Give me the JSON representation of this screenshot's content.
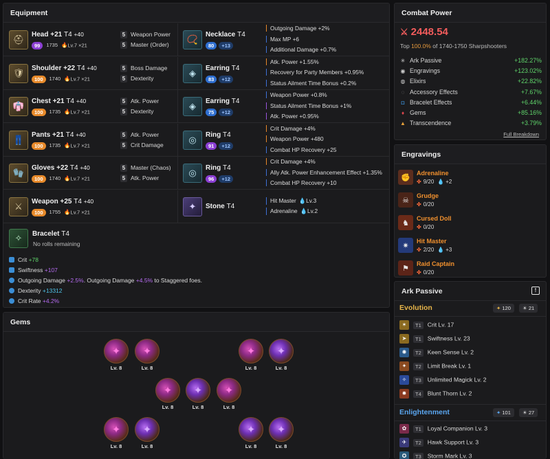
{
  "equipment": {
    "title": "Equipment",
    "armor": [
      {
        "slot": "Head",
        "upgrade": "+21",
        "tier": "T4",
        "adv": "+40",
        "quality": "99",
        "quality_color": "#8b3fd3",
        "ilvl": "1735",
        "elixir": "Lv.7 ×21",
        "icon": "⛑",
        "mods": [
          {
            "n": "5",
            "label": "Weapon Power"
          },
          {
            "n": "5",
            "label": "Master (Order)"
          }
        ]
      },
      {
        "slot": "Shoulder",
        "upgrade": "+22",
        "tier": "T4",
        "adv": "+40",
        "quality": "100",
        "quality_color": "#e78a2b",
        "ilvl": "1740",
        "elixir": "Lv.7 ×21",
        "icon": "🛡",
        "mods": [
          {
            "n": "5",
            "label": "Boss Damage"
          },
          {
            "n": "5",
            "label": "Dexterity"
          }
        ]
      },
      {
        "slot": "Chest",
        "upgrade": "+21",
        "tier": "T4",
        "adv": "+40",
        "quality": "100",
        "quality_color": "#e78a2b",
        "ilvl": "1735",
        "elixir": "Lv.7 ×21",
        "icon": "👘",
        "mods": [
          {
            "n": "5",
            "label": "Atk. Power"
          },
          {
            "n": "5",
            "label": "Dexterity"
          }
        ]
      },
      {
        "slot": "Pants",
        "upgrade": "+21",
        "tier": "T4",
        "adv": "+40",
        "quality": "100",
        "quality_color": "#e78a2b",
        "ilvl": "1735",
        "elixir": "Lv.7 ×21",
        "icon": "👖",
        "mods": [
          {
            "n": "5",
            "label": "Atk. Power"
          },
          {
            "n": "5",
            "label": "Crit Damage"
          }
        ]
      },
      {
        "slot": "Gloves",
        "upgrade": "+22",
        "tier": "T4",
        "adv": "+40",
        "quality": "100",
        "quality_color": "#e78a2b",
        "ilvl": "1740",
        "elixir": "Lv.7 ×21",
        "icon": "🧤",
        "mods": [
          {
            "n": "5",
            "label": "Master (Chaos)"
          },
          {
            "n": "5",
            "label": "Atk. Power"
          }
        ]
      },
      {
        "slot": "Weapon",
        "upgrade": "+25",
        "tier": "T4",
        "adv": "+40",
        "quality": "100",
        "quality_color": "#e78a2b",
        "ilvl": "1755",
        "elixir": "Lv.7 ×21",
        "icon": "⚔",
        "mods": []
      }
    ],
    "accessories": [
      {
        "slot": "Necklace",
        "tier": "T4",
        "quality": "80",
        "quality_color": "#2f6fd0",
        "bonus": "+13",
        "icon": "📿",
        "effects": [
          {
            "text": "Outgoing Damage +2%",
            "bar": "o"
          },
          {
            "text": "Max MP +6",
            "bar": "b"
          },
          {
            "text": "Additional Damage +0.7%",
            "bar": "b"
          }
        ]
      },
      {
        "slot": "Earring",
        "tier": "T4",
        "quality": "83",
        "quality_color": "#2f6fd0",
        "bonus": "+12",
        "icon": "◈",
        "effects": [
          {
            "text": "Atk. Power +1.55%",
            "bar": "o"
          },
          {
            "text": "Recovery for Party Members +0.95%",
            "bar": "b"
          },
          {
            "text": "Status Ailment Time Bonus +0.2%",
            "bar": "b"
          }
        ]
      },
      {
        "slot": "Earring",
        "tier": "T4",
        "quality": "75",
        "quality_color": "#2f6fd0",
        "bonus": "+12",
        "icon": "◈",
        "effects": [
          {
            "text": "Weapon Power +0.8%",
            "bar": "b"
          },
          {
            "text": "Status Ailment Time Bonus +1%",
            "bar": "p"
          },
          {
            "text": "Atk. Power +0.95%",
            "bar": "p"
          }
        ]
      },
      {
        "slot": "Ring",
        "tier": "T4",
        "quality": "91",
        "quality_color": "#8b3fd3",
        "bonus": "+12",
        "icon": "◎",
        "effects": [
          {
            "text": "Crit Damage +4%",
            "bar": "o"
          },
          {
            "text": "Weapon Power +480",
            "bar": "o"
          },
          {
            "text": "Combat HP Recovery +25",
            "bar": "b"
          }
        ]
      },
      {
        "slot": "Ring",
        "tier": "T4",
        "quality": "96",
        "quality_color": "#8b3fd3",
        "bonus": "+12",
        "icon": "◎",
        "effects": [
          {
            "text": "Crit Damage +4%",
            "bar": "o"
          },
          {
            "text": "Ally Atk. Power Enhancement Effect +1.35%",
            "bar": "b"
          },
          {
            "text": "Combat HP Recovery +10",
            "bar": "b"
          }
        ]
      },
      {
        "slot": "Stone",
        "tier": "T4",
        "icon": "✦",
        "effects": [
          {
            "text": "Hit Master",
            "lv": "Lv.3",
            "bar": "b"
          },
          {
            "text": "Adrenaline",
            "lv": "Lv.2",
            "bar": "b"
          }
        ]
      }
    ],
    "bracelet": {
      "slot": "Bracelet",
      "tier": "T4",
      "note": "No rolls remaining",
      "icon": "✧",
      "stats": [
        {
          "icon": "lock",
          "label": "Crit",
          "value": "+78",
          "color": "#5fd36a"
        },
        {
          "icon": "lock",
          "label": "Swiftness",
          "value": "+107",
          "color": "#b56bf0"
        },
        {
          "icon": "reroll",
          "label": "Outgoing Damage",
          "value": "+2.5%",
          "color": "#b56bf0",
          "label2": ". Outgoing Damage",
          "value2": "+4.5%",
          "label3": " to Staggered foes."
        },
        {
          "icon": "reroll",
          "label": "Dexterity",
          "value": "+13312",
          "color": "#4fc3e8"
        },
        {
          "icon": "reroll",
          "label": "Crit Rate",
          "value": "+4.2%",
          "color": "#b56bf0"
        }
      ]
    }
  },
  "gems": {
    "title": "Gems",
    "items": [
      {
        "lv": "Lv. 8",
        "kind": "damage"
      },
      {
        "lv": "Lv. 8",
        "kind": "damage"
      },
      {
        "lv": "Lv. 8",
        "kind": "damage"
      },
      {
        "lv": "Lv. 8",
        "kind": "cooldown"
      },
      {
        "lv": "Lv. 8",
        "kind": "damage"
      },
      {
        "lv": "Lv. 8",
        "kind": "cooldown"
      },
      {
        "lv": "Lv. 8",
        "kind": "damage"
      },
      {
        "lv": "Lv. 8",
        "kind": "damage"
      },
      {
        "lv": "Lv. 8",
        "kind": "cooldown"
      },
      {
        "lv": "Lv. 8",
        "kind": "cooldown"
      },
      {
        "lv": "Lv. 8",
        "kind": "cooldown"
      }
    ]
  },
  "combat_power": {
    "title": "Combat Power",
    "value": "2448.54",
    "top_prefix": "Top ",
    "top_pct": "100.0%",
    "top_suffix": " of 1740-1750 Sharpshooters",
    "rows": [
      {
        "label": "Ark Passive",
        "value": "+182.27%",
        "icon": "✳",
        "color": "#cfcfcf"
      },
      {
        "label": "Engravings",
        "value": "+123.02%",
        "icon": "◉",
        "color": "#cfcfcf"
      },
      {
        "label": "Elixirs",
        "value": "+22.82%",
        "icon": "◍",
        "color": "#cfcfcf"
      },
      {
        "label": "Accessory Effects",
        "value": "+7.67%",
        "icon": "◌",
        "color": "#8e8e8e"
      },
      {
        "label": "Bracelet Effects",
        "value": "+6.44%",
        "icon": "◘",
        "color": "#3b8ed6"
      },
      {
        "label": "Gems",
        "value": "+85.16%",
        "icon": "♦",
        "color": "#e2484f"
      },
      {
        "label": "Transcendence",
        "value": "+3.79%",
        "icon": "▲",
        "color": "#e8a23a"
      }
    ],
    "link": "Full Breakdown"
  },
  "engravings": {
    "title": "Engravings",
    "items": [
      {
        "name": "Adrenaline",
        "level": "9/20",
        "stone": "+2",
        "icon": "✊",
        "bg": "#5b2d1e"
      },
      {
        "name": "Grudge",
        "level": "0/20",
        "icon": "☠",
        "bg": "#4a2418"
      },
      {
        "name": "Cursed Doll",
        "level": "0/20",
        "icon": "♞",
        "bg": "#6a2a18"
      },
      {
        "name": "Hit Master",
        "level": "2/20",
        "stone": "+3",
        "icon": "✷",
        "bg": "#243a7a"
      },
      {
        "name": "Raid Captain",
        "level": "0/20",
        "icon": "⚑",
        "bg": "#5c2418"
      }
    ]
  },
  "ark_passive": {
    "title": "Ark Passive",
    "warn": "!",
    "evolution": {
      "title": "Evolution",
      "pts1": "120",
      "pts2": "21",
      "nodes": [
        {
          "tier": "T1",
          "text": "Crit Lv. 17",
          "icon": "✶",
          "bg": "#8a6a20"
        },
        {
          "tier": "T1",
          "text": "Swiftness Lv. 23",
          "icon": "➤",
          "bg": "#8a6a20"
        },
        {
          "tier": "T2",
          "text": "Keen Sense Lv. 2",
          "icon": "✺",
          "bg": "#2a5a8a"
        },
        {
          "tier": "T2",
          "text": "Limit Break Lv. 1",
          "icon": "✦",
          "bg": "#8a4a20"
        },
        {
          "tier": "T3",
          "text": "Unlimited Magick Lv. 2",
          "icon": "✧",
          "bg": "#2a4a9a"
        },
        {
          "tier": "T4",
          "text": "Blunt Thorn Lv. 2",
          "icon": "✹",
          "bg": "#8a3a20"
        }
      ]
    },
    "enlightenment": {
      "title": "Enlightenment",
      "pts1": "101",
      "pts2": "27",
      "nodes": [
        {
          "tier": "T1",
          "text": "Loyal Companion Lv. 3",
          "icon": "✿",
          "bg": "#7a2a4a"
        },
        {
          "tier": "T2",
          "text": "Hawk Support Lv. 3",
          "icon": "✈",
          "bg": "#3a3a7a"
        },
        {
          "tier": "T3",
          "text": "Storm Mark Lv. 3",
          "icon": "✪",
          "bg": "#2a5a7a"
        }
      ]
    }
  }
}
